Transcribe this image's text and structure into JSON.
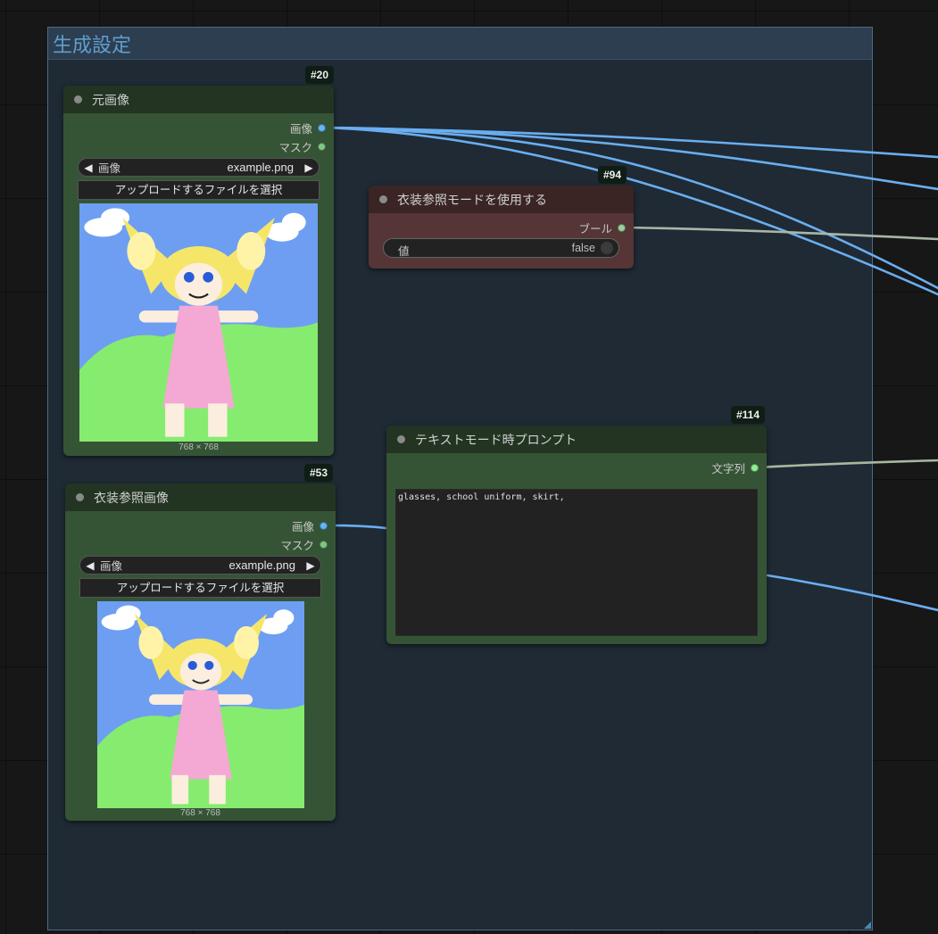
{
  "group": {
    "title": "生成設定"
  },
  "nodes": {
    "source_image": {
      "id": "#20",
      "title": "元画像",
      "outputs": [
        "画像",
        "マスク"
      ],
      "combo": {
        "label": "画像",
        "value": "example.png"
      },
      "upload_label": "アップロードするファイルを選択",
      "dims": "768 × 768"
    },
    "costume_mode": {
      "id": "#94",
      "title": "衣装参照モードを使用する",
      "output": "ブール",
      "toggle": {
        "label": "値",
        "value": "false"
      }
    },
    "costume_image": {
      "id": "#53",
      "title": "衣装参照画像",
      "outputs": [
        "画像",
        "マスク"
      ],
      "combo": {
        "label": "画像",
        "value": "example.png"
      },
      "upload_label": "アップロードするファイルを選択",
      "dims": "768 × 768"
    },
    "text_prompt": {
      "id": "#114",
      "title": "テキストモード時プロンプト",
      "output": "文字列",
      "text": "glasses, school uniform, skirt,"
    }
  },
  "colors": {
    "image_wire": "#6aaef0",
    "bool_wire": "#a9b7a5",
    "string_wire": "#a7b8a0",
    "node_green": "#355435",
    "node_red": "#553535",
    "group_title": "#5f9ed1"
  },
  "icons": {
    "combo_left": "◀",
    "combo_right": "▶"
  }
}
